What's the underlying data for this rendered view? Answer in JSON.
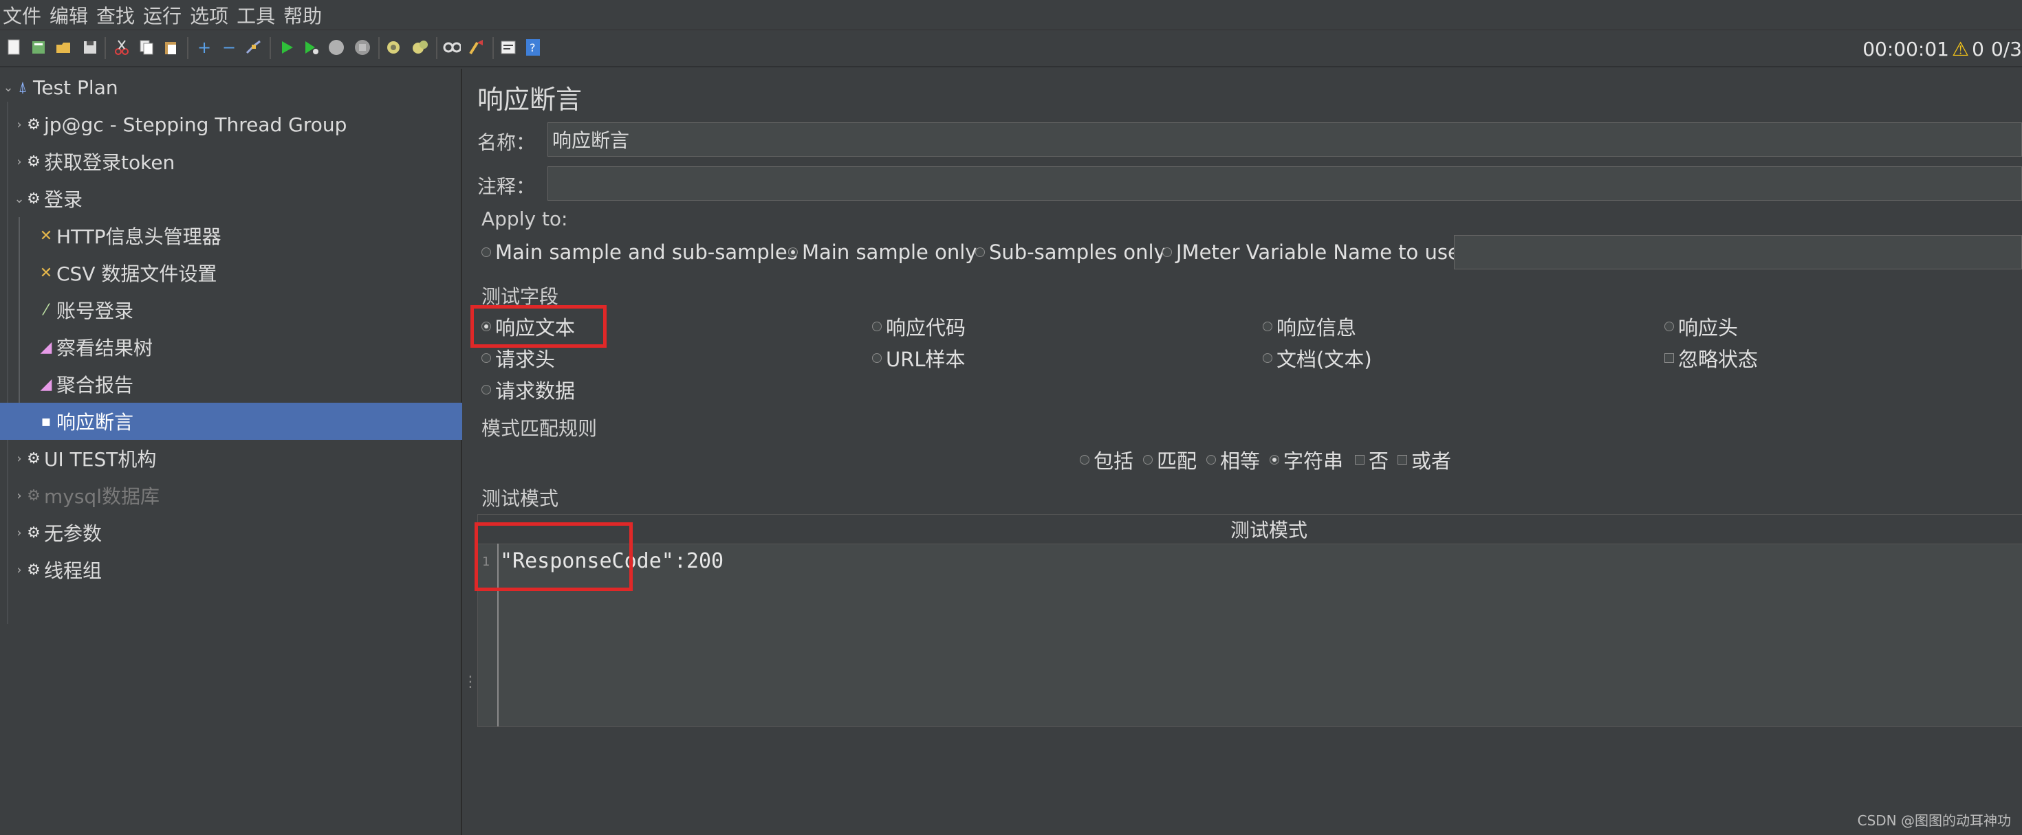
{
  "menu": [
    "文件",
    "编辑",
    "查找",
    "运行",
    "选项",
    "工具",
    "帮助"
  ],
  "toolbar": {
    "icons": [
      "new-icon",
      "templates-icon",
      "open-icon",
      "save-icon",
      "cut-icon",
      "copy-icon",
      "paste-icon",
      "expand-icon",
      "collapse-icon",
      "toggle-icon",
      "start-icon",
      "start-no-pause-icon",
      "stop-icon",
      "shutdown-icon",
      "clear-icon",
      "clear-all-icon",
      "search-icon",
      "reset-search-icon",
      "function-helper-icon",
      "help-icon"
    ]
  },
  "status": {
    "timer": "00:00:01",
    "warnings": "0",
    "threads": "0/3"
  },
  "tree": {
    "nodes": [
      {
        "label": "Test Plan",
        "icon": "test-plan-icon",
        "expanded": true
      },
      {
        "label": "jp@gc - Stepping Thread Group",
        "icon": "gear-icon"
      },
      {
        "label": "获取登录token",
        "icon": "gear-icon"
      },
      {
        "label": "登录",
        "icon": "gear-icon",
        "expanded": true
      },
      {
        "label": "HTTP信息头管理器",
        "icon": "config-icon"
      },
      {
        "label": "CSV 数据文件设置",
        "icon": "config-icon"
      },
      {
        "label": "账号登录",
        "icon": "sampler-icon"
      },
      {
        "label": "察看结果树",
        "icon": "listener-icon"
      },
      {
        "label": "聚合报告",
        "icon": "listener-icon"
      },
      {
        "label": "响应断言",
        "icon": "assertion-icon",
        "selected": true
      },
      {
        "label": "UI TEST机构",
        "icon": "gear-icon"
      },
      {
        "label": "mysql数据库",
        "icon": "gear-icon",
        "disabled": true
      },
      {
        "label": "无参数",
        "icon": "gear-icon"
      },
      {
        "label": "线程组",
        "icon": "gear-icon"
      }
    ]
  },
  "editor": {
    "title": "响应断言",
    "name_label": "名称：",
    "name_value": "响应断言",
    "comment_label": "注释：",
    "comment_value": "",
    "apply_to": {
      "label": "Apply to:",
      "options": [
        "Main sample and sub-samples",
        "Main sample only",
        "Sub-samples only",
        "JMeter Variable Name to use"
      ],
      "selected": "Main sample only",
      "variable_value": ""
    },
    "fields": {
      "label": "测试字段",
      "options": [
        "响应文本",
        "响应代码",
        "响应信息",
        "响应头",
        "请求头",
        "URL样本",
        "文档(文本)",
        "忽略状态",
        "请求数据"
      ],
      "selected": "响应文本"
    },
    "matching": {
      "label": "模式匹配规则",
      "options": [
        "包括",
        "匹配",
        "相等",
        "字符串",
        "否",
        "或者"
      ],
      "selected": "字符串"
    },
    "patterns": {
      "label": "测试模式",
      "column": "测试模式",
      "line_number": "1",
      "value": "\"ResponseCode\":200"
    },
    "accent": "#e02828"
  },
  "watermark": "CSDN @图图的动耳神功"
}
